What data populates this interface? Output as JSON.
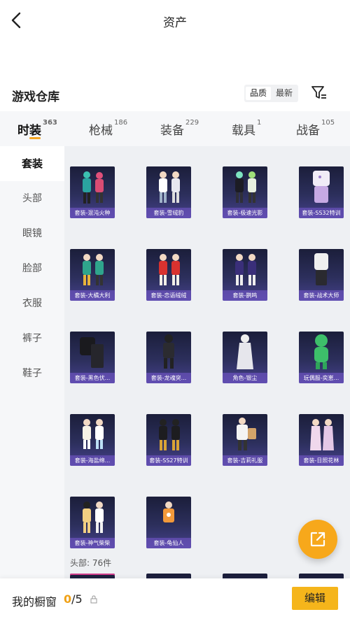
{
  "header": {
    "title": "资产"
  },
  "warehouse": {
    "title": "游戏仓库",
    "sort_quality": "品质",
    "sort_latest": "最新"
  },
  "categories": [
    {
      "label": "时装",
      "count": "363"
    },
    {
      "label": "枪械",
      "count": "186"
    },
    {
      "label": "装备",
      "count": "229"
    },
    {
      "label": "载具",
      "count": "1"
    },
    {
      "label": "战备",
      "count": "105"
    }
  ],
  "sidebar": {
    "items": [
      {
        "label": "套装"
      },
      {
        "label": "头部"
      },
      {
        "label": "眼镜"
      },
      {
        "label": "脸部"
      },
      {
        "label": "衣服"
      },
      {
        "label": "裤子"
      },
      {
        "label": "鞋子"
      }
    ]
  },
  "items": [
    {
      "name": "套装-混沌火种"
    },
    {
      "name": "套装-雪绒豹"
    },
    {
      "name": "套装-极速光影"
    },
    {
      "name": "套装-SS32特训"
    },
    {
      "name": "套装-大橘大利"
    },
    {
      "name": "套装-恋语绒绒"
    },
    {
      "name": "套装-鹊鸣"
    },
    {
      "name": "套装-战术大师"
    },
    {
      "name": "套装-黑色伏..."
    },
    {
      "name": "套装-龙魂突..."
    },
    {
      "name": "角色-银尘"
    },
    {
      "name": "玩偶服-奕崽..."
    },
    {
      "name": "套装-海盐绵..."
    },
    {
      "name": "套装-SS27特训"
    },
    {
      "name": "套装-吉莉礼服"
    },
    {
      "name": "套装-日照花林"
    },
    {
      "name": "套装-神气柴柴"
    },
    {
      "name": "套装-龟仙人"
    }
  ],
  "section": {
    "head_label": "头部: 76件"
  },
  "showcase": {
    "label": "我的橱窗",
    "current": "0",
    "total": "/5",
    "edit_label": "编辑"
  },
  "colors": {
    "accent": "#f5b51b",
    "card_bg": "#2c2f5c"
  }
}
